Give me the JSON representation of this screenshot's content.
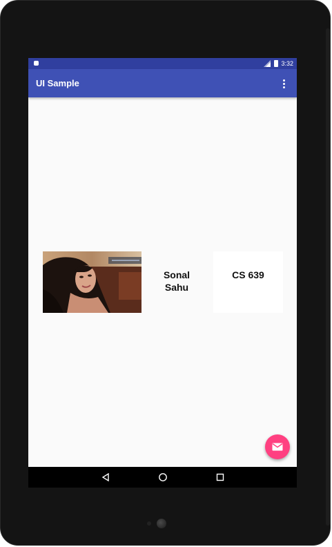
{
  "status_bar": {
    "time": "3:32",
    "icons": [
      "notification-icon",
      "signal-icon",
      "battery-icon"
    ]
  },
  "app_bar": {
    "title": "UI Sample",
    "menu_icon": "more-vert-icon"
  },
  "content": {
    "name_line1": "Sonal",
    "name_line2": "Sahu",
    "course": "CS 639"
  },
  "fab": {
    "icon": "mail-icon"
  },
  "nav_bar": {
    "icons": [
      "back-icon",
      "home-icon",
      "recents-icon"
    ]
  },
  "colors": {
    "primary": "#3f51b5",
    "primary_dark": "#303f9f",
    "accent": "#ff4081",
    "background": "#fafafa"
  }
}
